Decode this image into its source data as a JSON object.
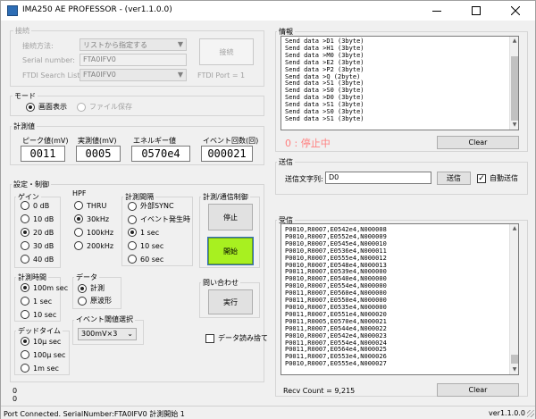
{
  "window": {
    "title": "IMA250 AE PROFESSOR - (ver1.1.0.0)"
  },
  "connection": {
    "group_title": "接続",
    "method_label": "接続方法:",
    "method_value": "リストから指定する",
    "serial_label": "Serial number:",
    "serial_value": "FTA0IFV0",
    "ftdi_label": "FTDI Search List:",
    "ftdi_value": "FTA0IFV0",
    "connect_button": "接続",
    "ftdi_port": "FTDI Port = 1"
  },
  "mode": {
    "group_title": "モード",
    "screen": "画面表示",
    "file": "ファイル保存"
  },
  "measurements": {
    "group_title": "計測値",
    "peak_label": "ピーク値(mV)",
    "peak_value": "0011",
    "effective_label": "実測値(mV)",
    "effective_value": "0005",
    "energy_label": "エネルギー値",
    "energy_value": "0570e4",
    "events_label": "イベント回数(回)",
    "events_value": "000021"
  },
  "settings": {
    "group_title": "設定・制御",
    "gain": {
      "title": "ゲイン",
      "options": [
        "0 dB",
        "10 dB",
        "20 dB",
        "30 dB",
        "40 dB"
      ]
    },
    "hpf": {
      "title": "HPF",
      "options": [
        "THRU",
        "30kHz",
        "100kHz",
        "200kHz"
      ]
    },
    "interval": {
      "title": "計測間隔",
      "options": [
        "外部SYNC",
        "イベント発生時",
        "1 sec",
        "10 sec",
        "60 sec"
      ]
    },
    "control": {
      "title": "計測/通信制御",
      "stop": "停止",
      "start": "開始"
    },
    "meas_time": {
      "title": "計測時間",
      "options": [
        "100m sec",
        "1 sec",
        "10 sec"
      ]
    },
    "data": {
      "title": "データ",
      "options": [
        "計測",
        "原波形"
      ]
    },
    "threshold": {
      "title": "イベント閾値選択",
      "value": "300mV×3"
    },
    "inquiry": {
      "title": "問い合わせ",
      "execute": "実行"
    },
    "dead_time": {
      "title": "デッドタイム",
      "options": [
        "10μ sec",
        "100μ sec",
        "1m sec"
      ]
    },
    "discard": "データ読み捨て"
  },
  "left_bottom": {
    "line1": "0",
    "line2": "0"
  },
  "info": {
    "group_title": "情報",
    "lines": [
      "Send data >D1 (3byte)",
      "Send data >H1 (3byte)",
      "Send data >M0 (3byte)",
      "Send data >E2 (3byte)",
      "Send data >P2 (3byte)",
      "Send data >Q (2byte)",
      "Send data >S1 (3byte)",
      "Send data >S0 (3byte)",
      "Send data >D0 (3byte)",
      "Send data >S1 (3byte)",
      "Send data >S0 (3byte)",
      "Send data >S1 (3byte)"
    ],
    "state": "0 : 停止中",
    "clear": "Clear"
  },
  "send": {
    "group_title": "送信",
    "label": "送信文字列:",
    "value": "D0",
    "button": "送信",
    "auto": "自動送信"
  },
  "recv": {
    "group_title": "受信",
    "lines": [
      "P0010,R0007,E0542e4,N000008",
      "P0010,R0007,E0552e4,N000009",
      "P0010,R0007,E0545e4,N000010",
      "P0010,R0007,E0536e4,N000011",
      "P0010,R0007,E0555e4,N000012",
      "P0010,R0007,E0548e4,N000013",
      "P0011,R0007,E0539e4,N000000",
      "P0010,R0007,E0540e4,N000000",
      "P0010,R0007,E0554e4,N000000",
      "P0011,R0007,E0560e4,N000000",
      "P0011,R0007,E0550e4,N000000",
      "P0010,R0007,E0535e4,N000000",
      "P0011,R0007,E0551e4,N000020",
      "P0011,R0005,E0570e4,N000021",
      "P0011,R0007,E0544e4,N000022",
      "P0010,R0007,E0542e4,N000023",
      "P0011,R0007,E0554e4,N000024",
      "P0011,R0007,E0564e4,N000025",
      "P0011,R0007,E0553e4,N000026",
      "P0010,R0007,E0555e4,N000027"
    ],
    "count": "Recv Count = 9,215",
    "clear": "Clear"
  },
  "status": {
    "text": "Port Connected.  SerialNumber:FTA0IFV0  計測開始 1",
    "version": "ver1.1.0.0"
  },
  "colors": {
    "start_green": "#a8f020",
    "state_red": "#ff8080"
  }
}
